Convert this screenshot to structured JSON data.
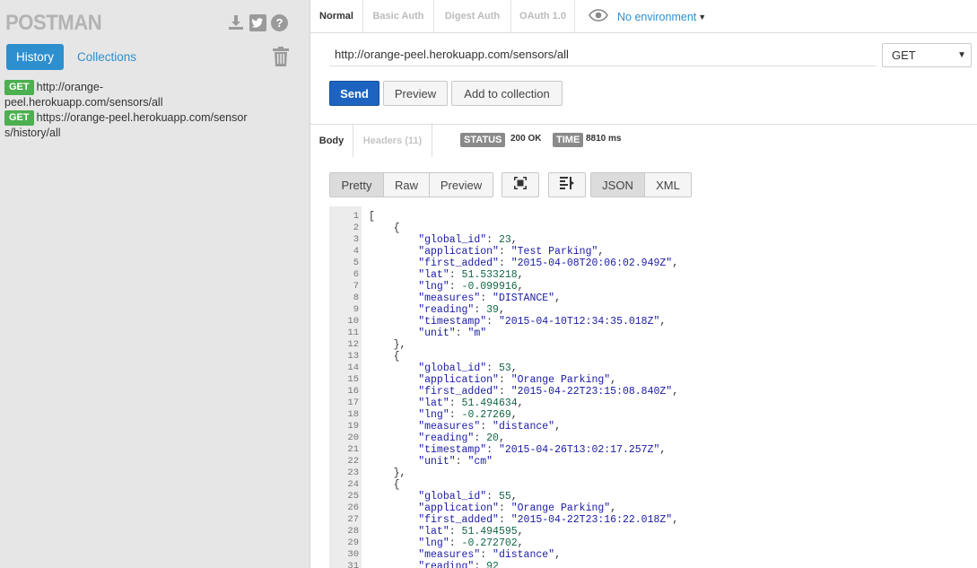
{
  "sidebar": {
    "logo": "POSTMAN",
    "tabs": {
      "history": "History",
      "collections": "Collections"
    },
    "history": [
      {
        "method": "GET",
        "url": "http://orange-peel.herokuapp.com/sensors/all"
      },
      {
        "method": "GET",
        "url_line1": "https://orange-peel.herokuapp.com/sensor",
        "url_line2": "s/history/all"
      }
    ]
  },
  "request": {
    "auth_tabs": [
      "Normal",
      "Basic Auth",
      "Digest Auth",
      "OAuth 1.0"
    ],
    "environment": "No environment",
    "url": "http://orange-peel.herokuapp.com/sensors/all",
    "method": "GET",
    "buttons": {
      "send": "Send",
      "preview": "Preview",
      "add_to_collection": "Add to collection"
    }
  },
  "response": {
    "tabs": {
      "body": "Body",
      "headers": "Headers (11)"
    },
    "status_label": "STATUS",
    "status_value": "200 OK",
    "time_label": "TIME",
    "time_value": "8810 ms",
    "view_modes": [
      "Pretty",
      "Raw",
      "Preview"
    ],
    "formats": [
      "JSON",
      "XML"
    ],
    "lines": [
      "[",
      "    {",
      "        \"global_id\": 23,",
      "        \"application\": \"Test Parking\",",
      "        \"first_added\": \"2015-04-08T20:06:02.949Z\",",
      "        \"lat\": 51.533218,",
      "        \"lng\": -0.099916,",
      "        \"measures\": \"DISTANCE\",",
      "        \"reading\": 39,",
      "        \"timestamp\": \"2015-04-10T12:34:35.018Z\",",
      "        \"unit\": \"m\"",
      "    },",
      "    {",
      "        \"global_id\": 53,",
      "        \"application\": \"Orange Parking\",",
      "        \"first_added\": \"2015-04-22T23:15:08.840Z\",",
      "        \"lat\": 51.494634,",
      "        \"lng\": -0.27269,",
      "        \"measures\": \"distance\",",
      "        \"reading\": 20,",
      "        \"timestamp\": \"2015-04-26T13:02:17.257Z\",",
      "        \"unit\": \"cm\"",
      "    },",
      "    {",
      "        \"global_id\": 55,",
      "        \"application\": \"Orange Parking\",",
      "        \"first_added\": \"2015-04-22T23:16:22.018Z\",",
      "        \"lat\": 51.494595,",
      "        \"lng\": -0.272702,",
      "        \"measures\": \"distance\",",
      "        \"reading\": 92"
    ]
  },
  "colors": {
    "accent": "#2e8fcf",
    "send": "#1c64c0",
    "get_badge": "#4caf50",
    "json_key": "#1a1aa6",
    "json_number": "#116644"
  },
  "icons": [
    "download-icon",
    "twitter-icon",
    "help-icon",
    "trash-icon",
    "eye-icon",
    "fullscreen-icon",
    "wrap-icon"
  ]
}
